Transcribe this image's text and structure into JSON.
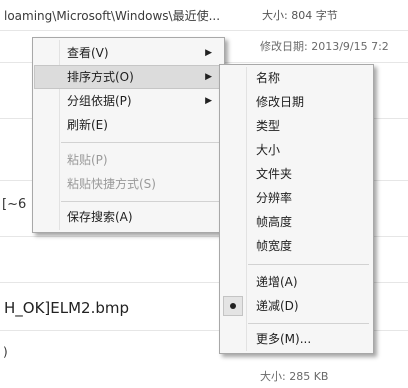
{
  "background": {
    "path_text": "loaming\\Microsoft\\Windows\\最近使...",
    "size_top": "大小: 804 字节",
    "date_text": "修改日期: 2013/9/15 7:2",
    "fragment_a": "[~6",
    "filename": "H_OK]ELM2.bmp",
    "fragment_b": ")",
    "size_bottom": "大小: 285 KB"
  },
  "context_menu": {
    "items": [
      {
        "label": "查看(V)",
        "has_submenu": true,
        "disabled": false
      },
      {
        "label": "排序方式(O)",
        "has_submenu": true,
        "disabled": false,
        "highlighted": true
      },
      {
        "label": "分组依据(P)",
        "has_submenu": true,
        "disabled": false
      },
      {
        "label": "刷新(E)",
        "has_submenu": false,
        "disabled": false
      },
      {
        "label": "粘贴(P)",
        "has_submenu": false,
        "disabled": true
      },
      {
        "label": "粘贴快捷方式(S)",
        "has_submenu": false,
        "disabled": true
      },
      {
        "label": "保存搜索(A)",
        "has_submenu": false,
        "disabled": false
      }
    ]
  },
  "sort_submenu": {
    "items": [
      {
        "label": "名称"
      },
      {
        "label": "修改日期"
      },
      {
        "label": "类型"
      },
      {
        "label": "大小"
      },
      {
        "label": "文件夹"
      },
      {
        "label": "分辨率"
      },
      {
        "label": "帧高度"
      },
      {
        "label": "帧宽度"
      },
      {
        "label": "递增(A)"
      },
      {
        "label": "递减(D)",
        "selected": true
      },
      {
        "label": "更多(M)..."
      }
    ]
  },
  "icons": {
    "submenu_arrow": "▶",
    "selected_bullet": "radio-bullet-icon"
  }
}
